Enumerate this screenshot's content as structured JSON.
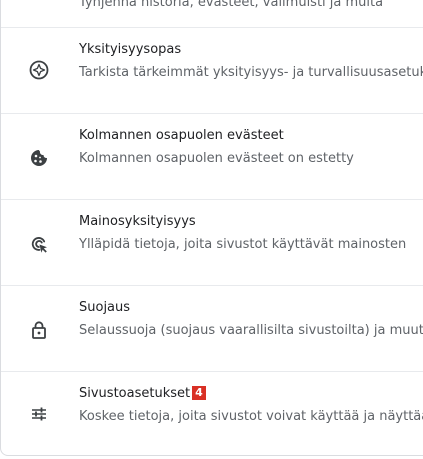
{
  "top_clipped_text": "Tyhjennä historia, evästeet, välimuisti ja muita",
  "rows": [
    {
      "title": "Yksityisyysopas",
      "subtitle": "Tarkista tärkeimmät yksityisyys- ja turvallisuusasetukset",
      "icon": "compass-icon"
    },
    {
      "title": "Kolmannen osapuolen evästeet",
      "subtitle": "Kolmannen osapuolen evästeet on estetty",
      "icon": "cookie-icon"
    },
    {
      "title": "Mainosyksityisyys",
      "subtitle": "Ylläpidä tietoja, joita sivustot käyttävät mainosten",
      "icon": "ad-privacy-icon"
    },
    {
      "title": "Suojaus",
      "subtitle": "Selaussuoja (suojaus vaarallisilta sivustoilta) ja muut",
      "icon": "lock-icon"
    },
    {
      "title": "Sivustoasetukset",
      "badge": "4",
      "subtitle": "Koskee tietoja, joita sivustot voivat käyttää ja näyttää",
      "icon": "tune-icon"
    }
  ],
  "colors": {
    "icon": "#3c4043",
    "title": "#202124",
    "subtitle": "#5f6368",
    "badge": "#d93025",
    "divider": "#e8eaed"
  }
}
